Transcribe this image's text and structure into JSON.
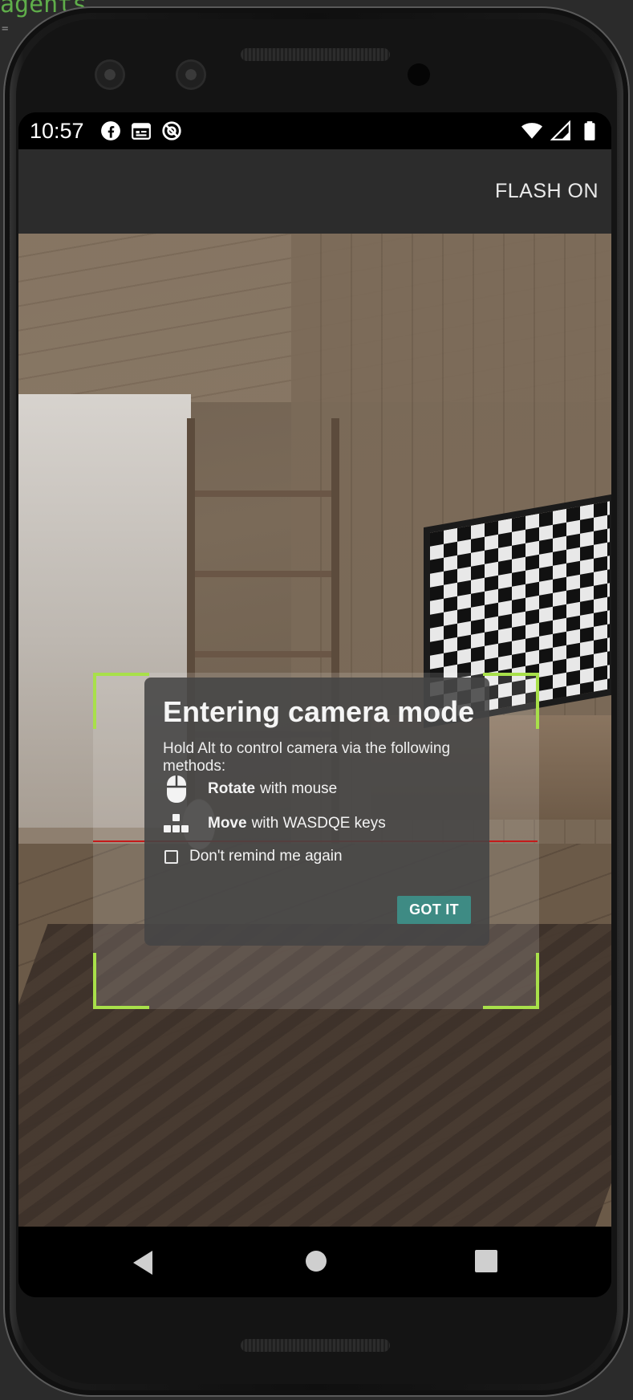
{
  "background_code": {
    "text": "agents",
    "marks": "="
  },
  "status_bar": {
    "time": "10:57",
    "left_icons": [
      "facebook-icon",
      "calendar-icon",
      "do-not-disturb-icon"
    ],
    "right_icons": [
      "wifi-icon",
      "cell-signal-icon",
      "battery-icon"
    ]
  },
  "app_bar": {
    "flash_label": "FLASH ON"
  },
  "dialog": {
    "title": "Entering camera mode",
    "body": "Hold Alt to control camera via the following methods:",
    "rotate": {
      "bold": "Rotate",
      "rest": "with mouse",
      "icon": "mouse-icon"
    },
    "move": {
      "bold": "Move",
      "rest": "with WASDQE keys",
      "icon": "keys-icon"
    },
    "dont_remind": "Don't remind me again",
    "dont_remind_checked": false,
    "button": "GOT IT"
  },
  "colors": {
    "accent": "#3e8b84",
    "scan_corner": "#a8e04a",
    "laser": "#c41a1a",
    "app_bar": "#2c2c2c"
  },
  "nav": {
    "icons": [
      "back-icon",
      "home-icon",
      "recents-icon"
    ]
  }
}
